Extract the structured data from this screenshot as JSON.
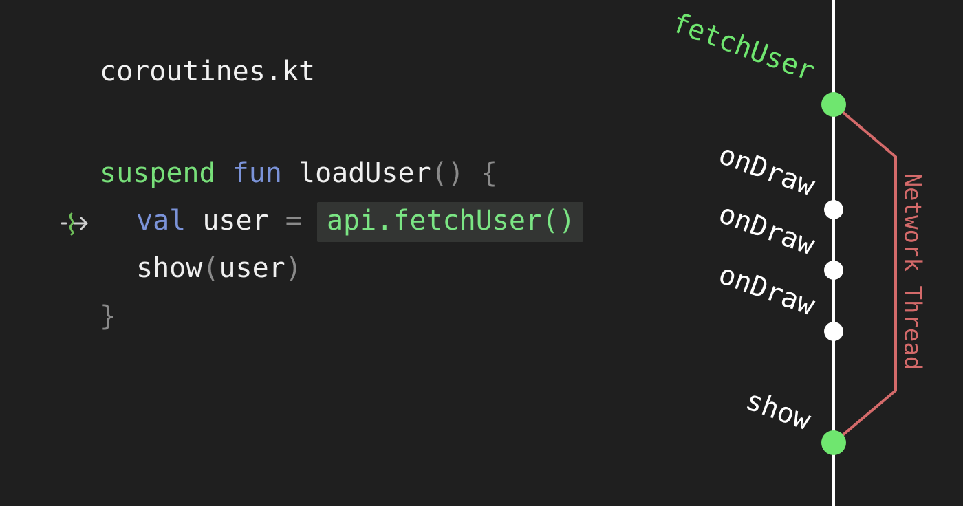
{
  "code": {
    "filename": "coroutines.kt",
    "line1": {
      "keyword_suspend": "suspend",
      "keyword_fun": "fun",
      "function_name": "loadUser",
      "open_paren": "(",
      "close_paren": ")",
      "brace": "{"
    },
    "line2": {
      "keyword_val": "val",
      "var_name": "user",
      "equals": "=",
      "call": "api.fetchUser()"
    },
    "line3": {
      "function_name": "show",
      "open_paren": "(",
      "arg": "user",
      "close_paren": ")"
    },
    "line4": {
      "brace": "}"
    },
    "suspend_icon": "suspend-call-icon"
  },
  "timeline": {
    "events": [
      {
        "label": "fetchUser",
        "type": "suspend",
        "color": "#6fe66f"
      },
      {
        "label": "onDraw",
        "type": "frame",
        "color": "#ffffff"
      },
      {
        "label": "onDraw",
        "type": "frame",
        "color": "#ffffff"
      },
      {
        "label": "onDraw",
        "type": "frame",
        "color": "#ffffff"
      },
      {
        "label": "show",
        "type": "resume",
        "color": "#6fe66f"
      }
    ],
    "thread_label": "Network Thread",
    "thread_color": "#d46a6a",
    "axis_color": "#ffffff"
  }
}
